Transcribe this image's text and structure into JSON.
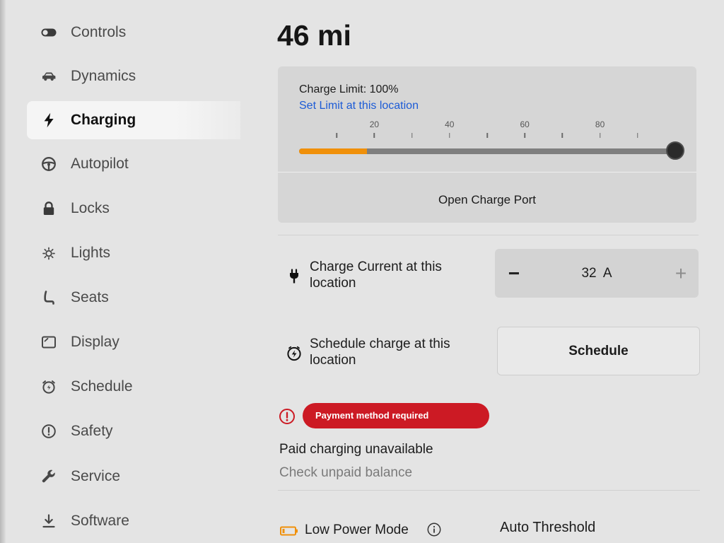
{
  "colors": {
    "background": "#e4e4e4",
    "panel": "#d6d6d6",
    "accent_orange": "#f0900a",
    "link_blue": "#1c5bd6",
    "alert_red": "#cc1a24",
    "text": "#1c1c1c",
    "text_muted": "#7a7a7a"
  },
  "sidebar": {
    "items": [
      {
        "label": "Controls",
        "icon": "toggle-icon",
        "selected": false
      },
      {
        "label": "Dynamics",
        "icon": "car-icon",
        "selected": false
      },
      {
        "label": "Charging",
        "icon": "lightning-icon",
        "selected": true
      },
      {
        "label": "Autopilot",
        "icon": "steering-wheel-icon",
        "selected": false
      },
      {
        "label": "Locks",
        "icon": "lock-icon",
        "selected": false
      },
      {
        "label": "Lights",
        "icon": "light-icon",
        "selected": false
      },
      {
        "label": "Seats",
        "icon": "seat-icon",
        "selected": false
      },
      {
        "label": "Display",
        "icon": "display-icon",
        "selected": false
      },
      {
        "label": "Schedule",
        "icon": "alarm-clock-icon",
        "selected": false
      },
      {
        "label": "Safety",
        "icon": "alert-circle-icon",
        "selected": false
      },
      {
        "label": "Service",
        "icon": "wrench-icon",
        "selected": false
      },
      {
        "label": "Software",
        "icon": "download-icon",
        "selected": false
      }
    ]
  },
  "header": {
    "range": "46 mi"
  },
  "charge_panel": {
    "limit_label": "Charge Limit: 100%",
    "set_limit_link": "Set Limit at this location",
    "scale_labels": [
      "20",
      "40",
      "60",
      "80"
    ],
    "limit_percent": 100,
    "battery_level_percent": 18,
    "open_port_button": "Open Charge Port"
  },
  "charge_current": {
    "icon": "plug-icon",
    "label": "Charge Current at this location",
    "decrease_label": "−",
    "value": "32 A",
    "increase_label": "+"
  },
  "schedule_charge": {
    "icon": "schedule-charge-icon",
    "label": "Schedule charge at this location",
    "button_label": "Schedule"
  },
  "paid_charging": {
    "icon": "alert-icon",
    "badge": "Payment method required",
    "title": "Paid charging unavailable",
    "subtitle": "Check unpaid balance"
  },
  "low_power_mode": {
    "icon": "battery-icon",
    "label": "Low Power Mode",
    "info_icon": "info-icon",
    "threshold": "Auto Threshold"
  }
}
